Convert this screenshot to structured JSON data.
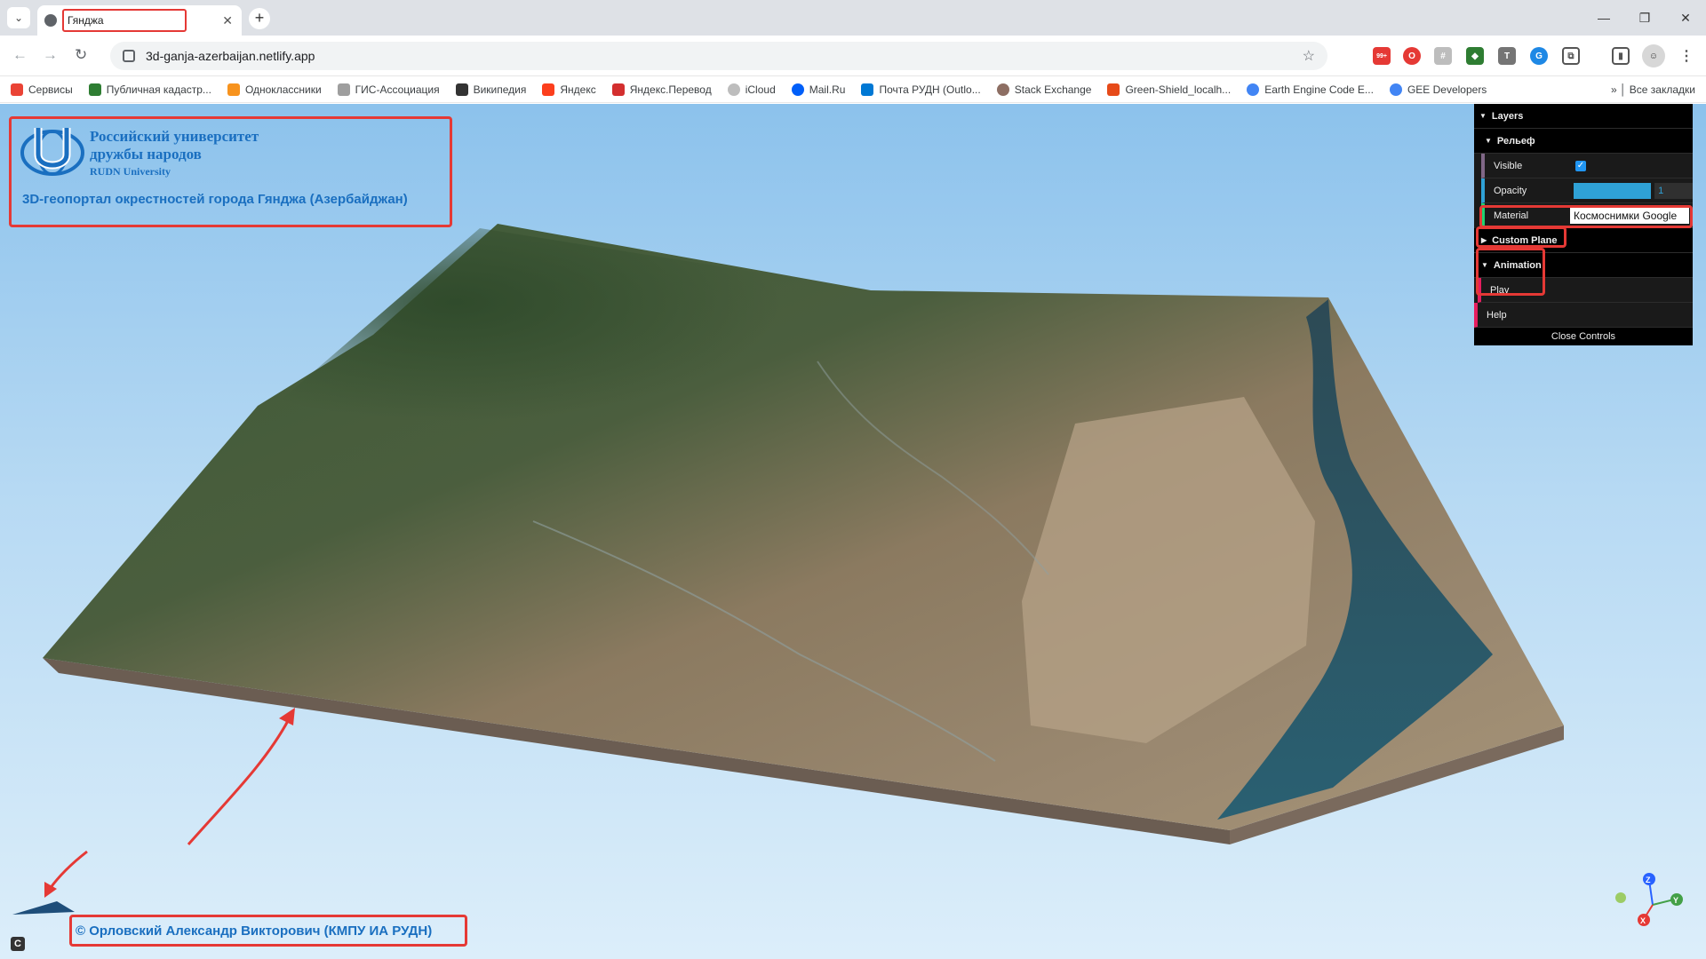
{
  "browser": {
    "tab_title": "Гянджа",
    "url": "3d-ganja-azerbaijan.netlify.app",
    "notification_badge": "99+",
    "bookmarks": [
      {
        "label": "Сервисы",
        "color": "#ea4335"
      },
      {
        "label": "Публичная кадастр...",
        "color": "#2e7d32"
      },
      {
        "label": "Одноклассники",
        "color": "#f7931e"
      },
      {
        "label": "ГИС-Ассоциация",
        "color": "#9e9e9e"
      },
      {
        "label": "Википедия",
        "color": "#333333"
      },
      {
        "label": "Яндекс",
        "color": "#fc3f1d"
      },
      {
        "label": "Яндекс.Перевод",
        "color": "#d32f2f"
      },
      {
        "label": "iCloud",
        "color": "#bdbdbd"
      },
      {
        "label": "Mail.Ru",
        "color": "#005ff9"
      },
      {
        "label": "Почта РУДН (Outlo...",
        "color": "#0078d4"
      },
      {
        "label": "Stack Exchange",
        "color": "#8d6e63"
      },
      {
        "label": "Green-Shield_localh...",
        "color": "#e64a19"
      },
      {
        "label": "Earth Engine Code E...",
        "color": "#4285f4"
      },
      {
        "label": "GEE Developers",
        "color": "#4285f4"
      }
    ],
    "all_bookmarks": "Все закладки"
  },
  "page": {
    "university_name_line1": "Российский университет",
    "university_name_line2": "дружбы народов",
    "university_name_en": "RUDN University",
    "portal_title": "3D-геопортал окрестностей города Гянджа (Азербайджан)",
    "author": "© Орловский Александр Викторович (КМПУ ИА РУДН)",
    "copyright_glyph": "C"
  },
  "controls": {
    "layers": "Layers",
    "relief": "Рельеф",
    "visible_label": "Visible",
    "visible_value": true,
    "opacity_label": "Opacity",
    "opacity_value": "1",
    "material_label": "Material",
    "material_value": "Космоснимки Google",
    "custom_plane": "Custom Plane",
    "animation": "Animation",
    "play": "Play",
    "help": "Help",
    "close_controls": "Close Controls"
  },
  "axes": {
    "x": "X",
    "y": "Y",
    "z": "Z"
  },
  "colors": {
    "accent": "#1a6fc0",
    "highlight": "#e53935"
  }
}
